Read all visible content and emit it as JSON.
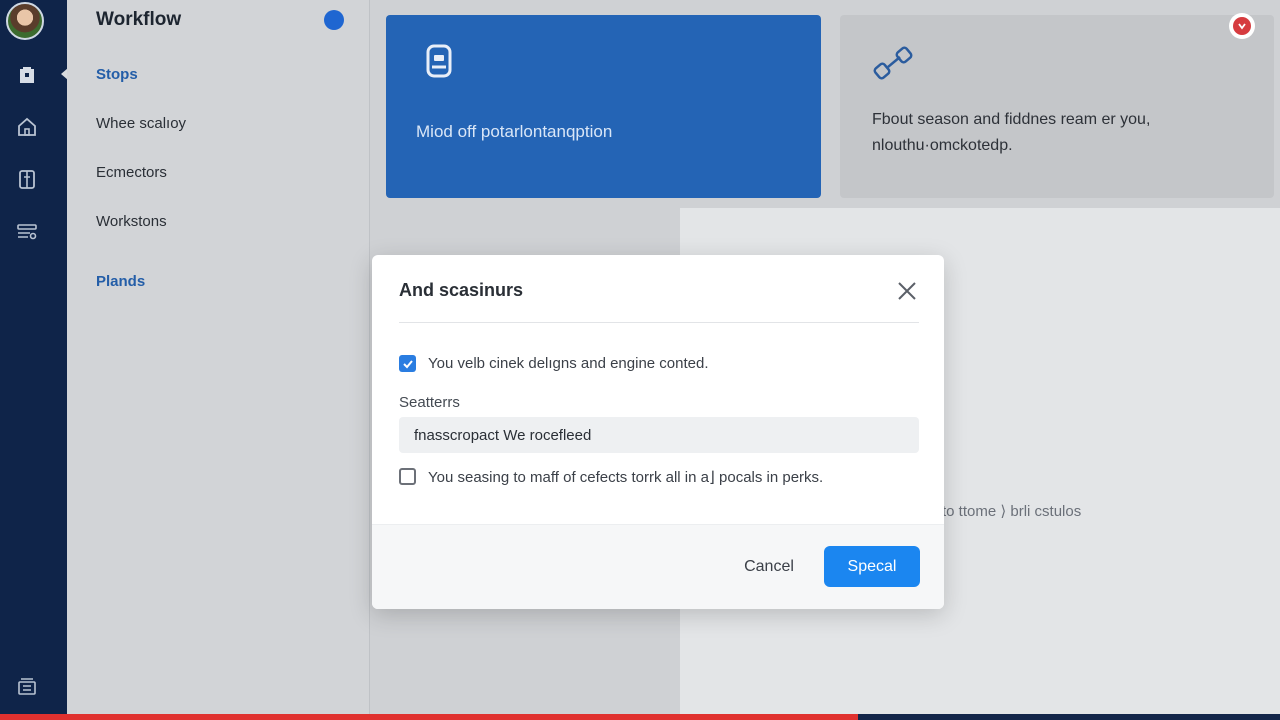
{
  "sidebar": {
    "title": "Workflow",
    "items": [
      {
        "label": "Stops",
        "type": "section"
      },
      {
        "label": "Whee scalıoy",
        "type": "item"
      },
      {
        "label": "Ecmectors",
        "type": "item"
      },
      {
        "label": "Workstons",
        "type": "item"
      },
      {
        "label": "Plands",
        "type": "section"
      }
    ]
  },
  "cards": {
    "blue": {
      "text": "Miod off potarlontanqption",
      "icon": "device-icon"
    },
    "gray": {
      "text": "Fbout season and fiddnes ream er you, nlouthu·omckotedp.",
      "icon": "link-icon"
    }
  },
  "panel": {
    "text": "to ttome ⟩ brli cstulos"
  },
  "dialog": {
    "title": "And scasinurs",
    "option1": {
      "label": "You velb cinek delıgns and engine conted.",
      "checked": true
    },
    "field_label": "Seatterrs",
    "field_value": "fnasscropact We rocefleed",
    "option2": {
      "label": "You seasing to maff of cefects torrk all in a⌋ pocals in perks.",
      "checked": false
    },
    "cancel_label": "Cancel",
    "primary_label": "Specal"
  },
  "progress": {
    "percent": 67
  },
  "colors": {
    "accent": "#1b86f0",
    "rail": "#0f2449",
    "card": "#2464b5",
    "alert": "#d63b3f"
  }
}
